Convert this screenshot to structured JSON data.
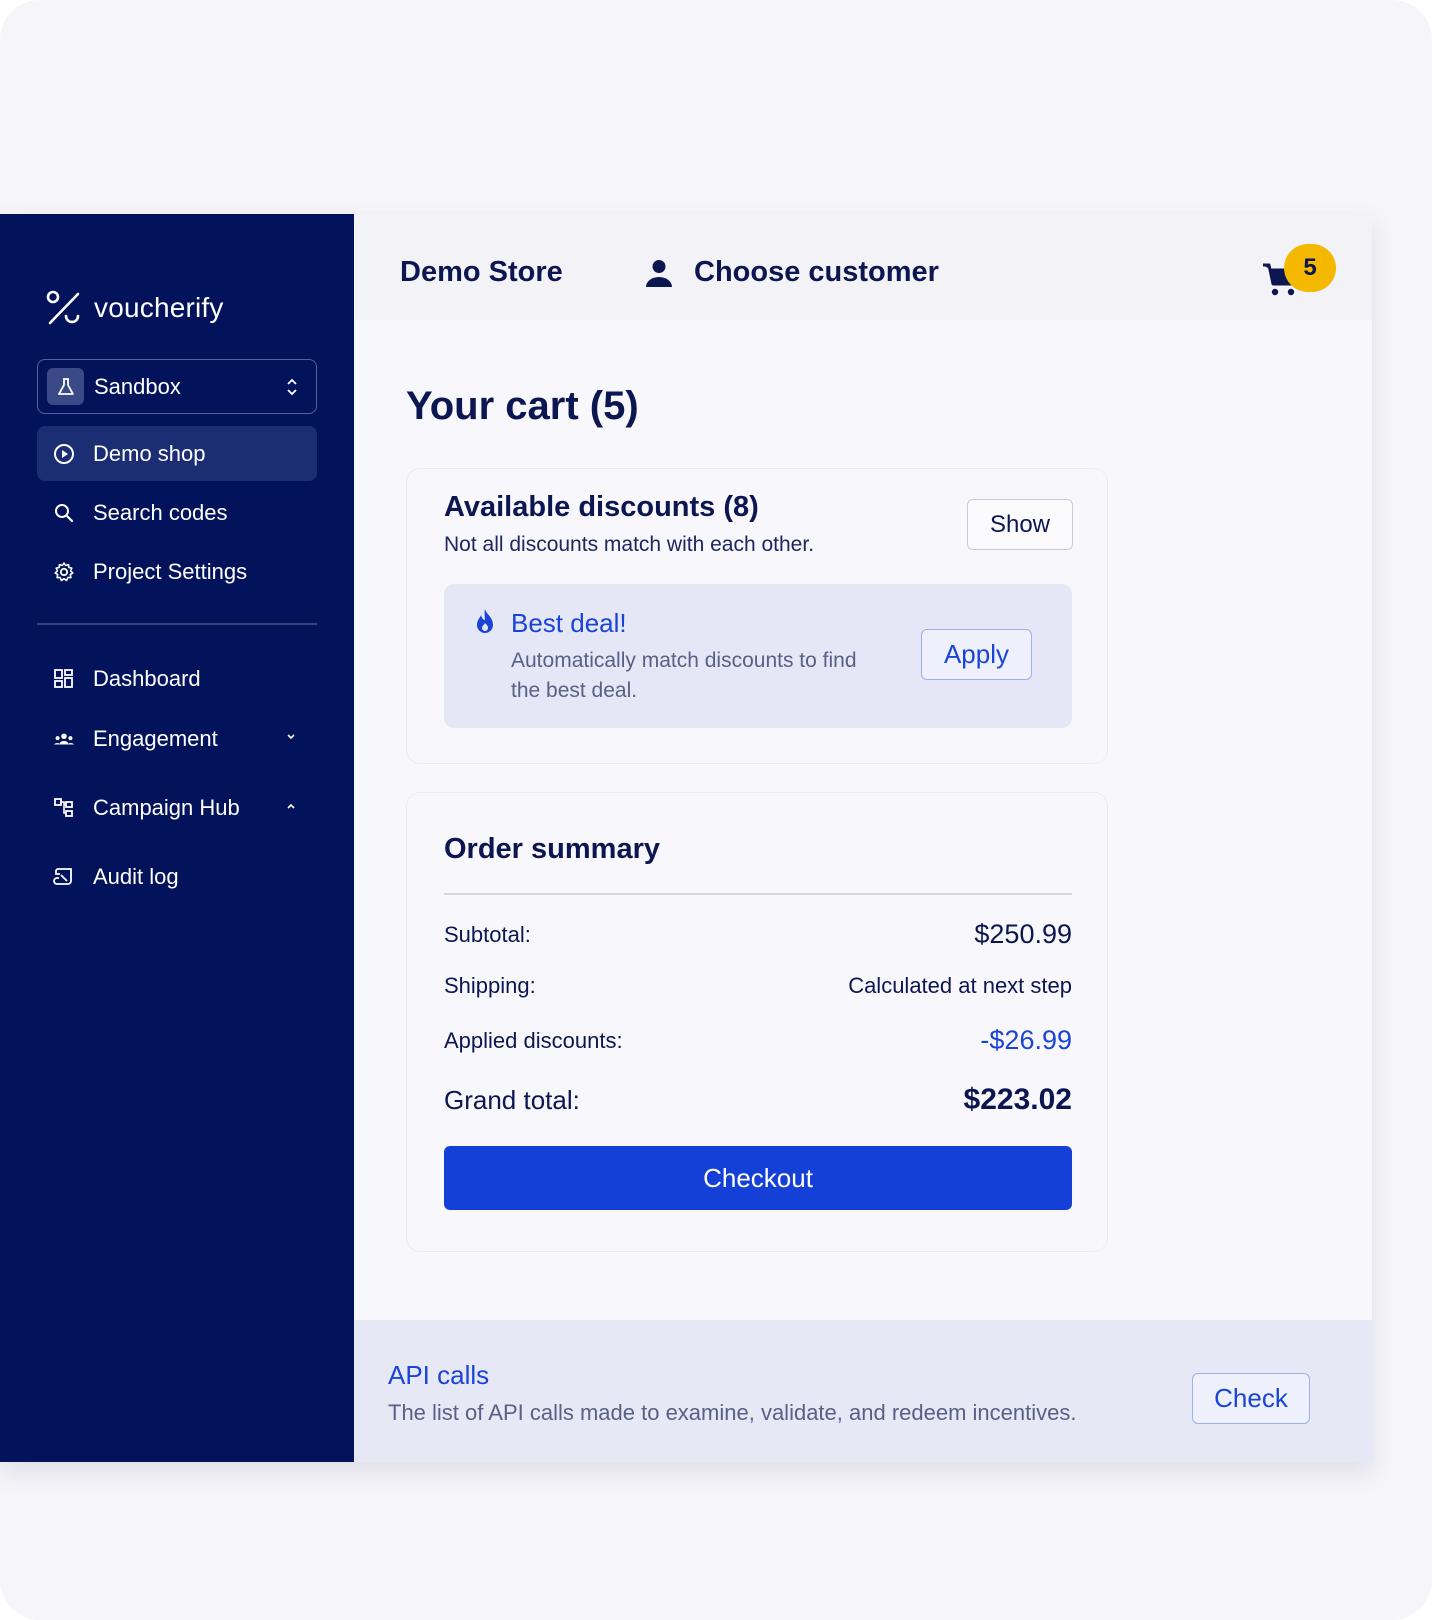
{
  "sidebar": {
    "logo_text": "voucherify",
    "environment": {
      "label": "Sandbox"
    },
    "items_top": [
      {
        "label": "Demo shop",
        "icon": "play-circle-icon",
        "active": true
      },
      {
        "label": "Search codes",
        "icon": "search-icon"
      },
      {
        "label": "Project Settings",
        "icon": "gear-icon"
      }
    ],
    "items_bottom": [
      {
        "label": "Dashboard",
        "icon": "dashboard-grid-icon"
      },
      {
        "label": "Engagement",
        "icon": "group-icon",
        "caret": "down"
      },
      {
        "label": "Campaign Hub",
        "icon": "hierarchy-icon",
        "caret": "up"
      },
      {
        "label": "Audit log",
        "icon": "scroll-icon"
      }
    ]
  },
  "topbar": {
    "store_name": "Demo Store",
    "customer_label": "Choose customer",
    "cart_count": "5"
  },
  "cart": {
    "heading": "Your cart (5)"
  },
  "discounts": {
    "title": "Available discounts (8)",
    "subtitle": "Not all discounts match with each other.",
    "show_label": "Show",
    "best_deal": {
      "title": "Best deal!",
      "description": "Automatically match discounts to find the best deal.",
      "apply_label": "Apply"
    }
  },
  "summary": {
    "title": "Order summary",
    "subtotal_label": "Subtotal:",
    "subtotal_value": "$250.99",
    "shipping_label": "Shipping:",
    "shipping_value": "Calculated at next step",
    "discounts_label": "Applied discounts:",
    "discounts_value": "-$26.99",
    "total_label": "Grand total:",
    "total_value": "$223.02",
    "checkout_label": "Checkout"
  },
  "api": {
    "title": "API calls",
    "description": "The list of API calls made to examine, validate, and redeem incentives.",
    "check_label": "Check"
  },
  "colors": {
    "sidebar_bg": "#02135b",
    "accent": "#1540d8",
    "badge": "#f5b800",
    "text_dark": "#0c1650"
  }
}
